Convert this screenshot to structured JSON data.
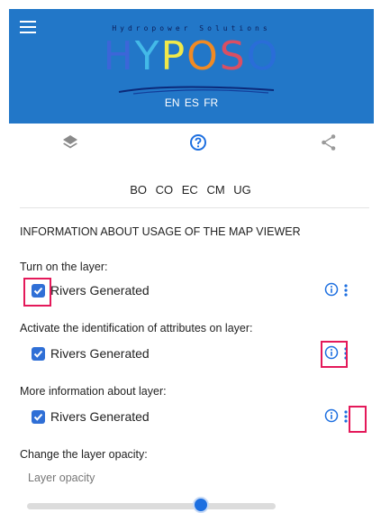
{
  "header": {
    "tagline": "Hydropower Solutions",
    "logo_letters": [
      "H",
      "Y",
      "P",
      "O",
      "S",
      "O"
    ],
    "languages": [
      "EN",
      "ES",
      "FR"
    ]
  },
  "toolbar": {
    "icons": [
      "layers-icon",
      "help-icon",
      "share-icon"
    ],
    "active": "help-icon"
  },
  "countries": [
    "BO",
    "CO",
    "EC",
    "CM",
    "UG"
  ],
  "help": {
    "heading": "INFORMATION ABOUT USAGE OF THE MAP VIEWER",
    "steps": [
      {
        "text": "Turn on the layer:",
        "layer": "Rivers Generated",
        "checked": true
      },
      {
        "text": "Activate the identification of attributes on layer:",
        "layer": "Rivers Generated",
        "checked": true
      },
      {
        "text": "More information about layer:",
        "layer": "Rivers Generated",
        "checked": true
      }
    ],
    "opacity_text": "Change the layer opacity:",
    "opacity_label": "Layer opacity",
    "opacity_value": 0.7
  },
  "colors": {
    "header_bg": "#2277c8",
    "accent": "#2f6fd6",
    "highlight": "#e4195a"
  }
}
